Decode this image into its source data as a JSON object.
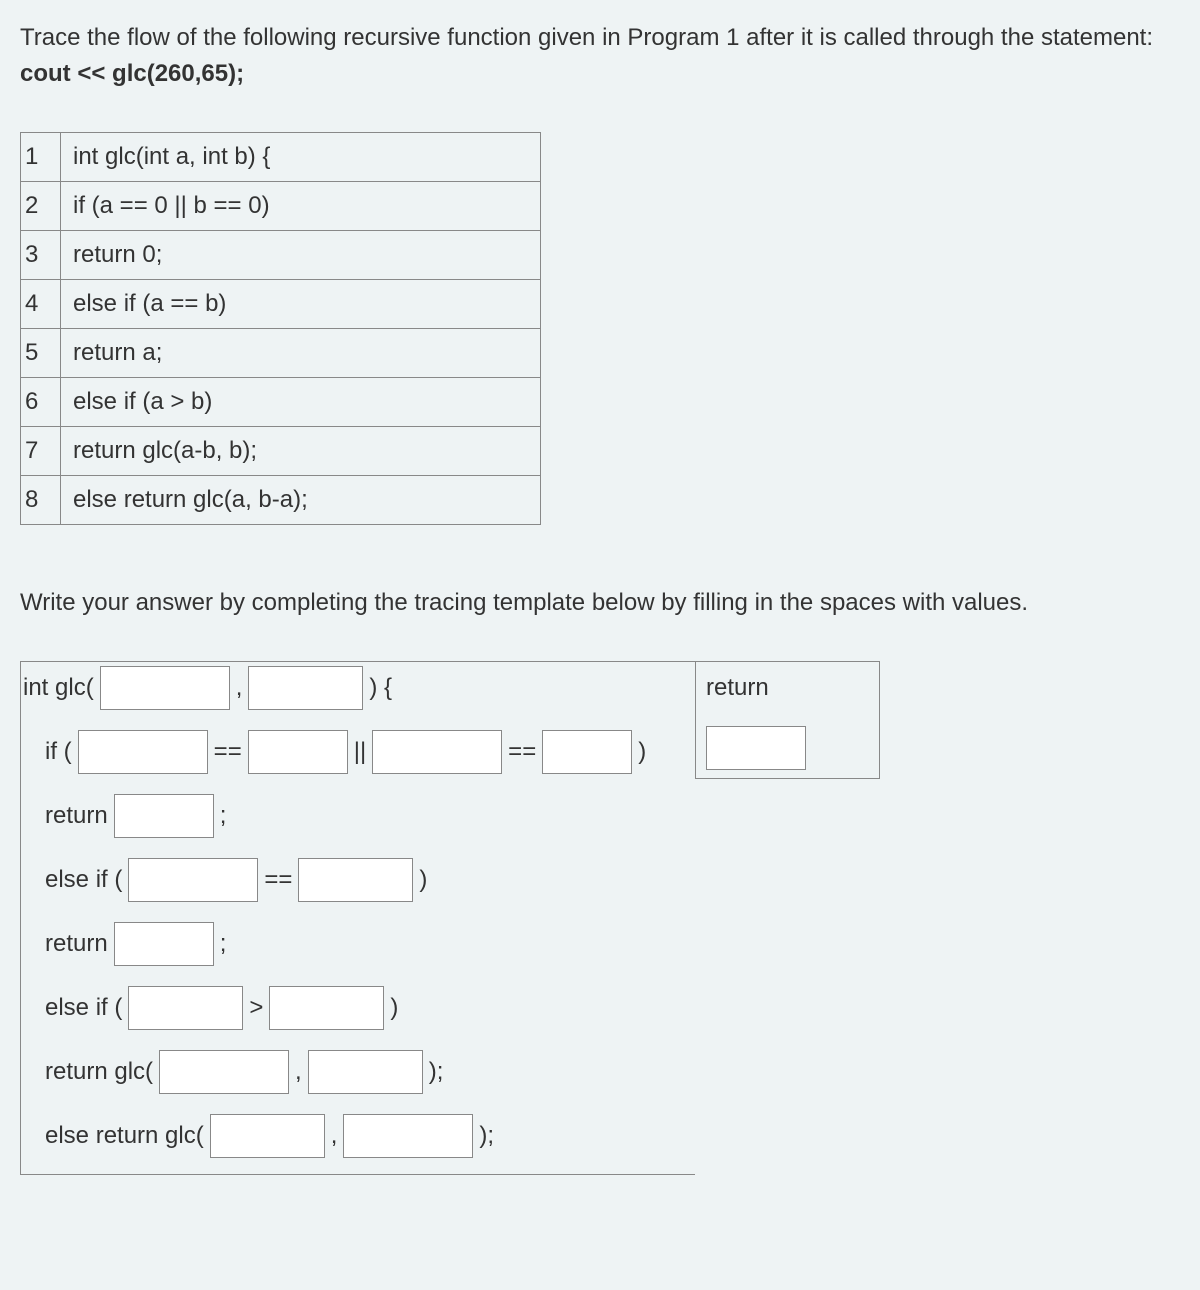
{
  "question": {
    "part1": "Trace the flow of the following recursive function given in Program 1 after it is called through the statement: ",
    "bold": "cout << glc(260,65);"
  },
  "code": {
    "lines": [
      {
        "num": "1",
        "text": "int glc(int a, int b) {"
      },
      {
        "num": "2",
        "text": "if (a == 0 || b == 0)"
      },
      {
        "num": "3",
        "text": "return 0;"
      },
      {
        "num": "4",
        "text": "else if (a == b)"
      },
      {
        "num": "5",
        "text": "return a;"
      },
      {
        "num": "6",
        "text": "else if (a > b)"
      },
      {
        "num": "7",
        "text": "return glc(a-b, b);"
      },
      {
        "num": "8",
        "text": "else return glc(a, b-a);"
      }
    ]
  },
  "instructions": "Write your answer by completing the tracing template below by filling in the spaces with values.",
  "template": {
    "sig": {
      "pre": "int glc(",
      "comma": ",",
      "post": ") {"
    },
    "if1": {
      "pre": "if (",
      "eq": "==",
      "or": "||",
      "eq2": "==",
      "post": ")"
    },
    "ret1": {
      "pre": "return",
      "post": ";"
    },
    "elif1": {
      "pre": "else if (",
      "eq": "==",
      "post": ")"
    },
    "ret2": {
      "pre": "return",
      "post": ";"
    },
    "elif2": {
      "pre": "else if (",
      "gt": ">",
      "post": ")"
    },
    "retglc": {
      "pre": "return glc(",
      "comma": ",",
      "post": ");"
    },
    "elseret": {
      "pre": "else return glc(",
      "comma": ",",
      "post": ");"
    },
    "returnCol": "return"
  }
}
